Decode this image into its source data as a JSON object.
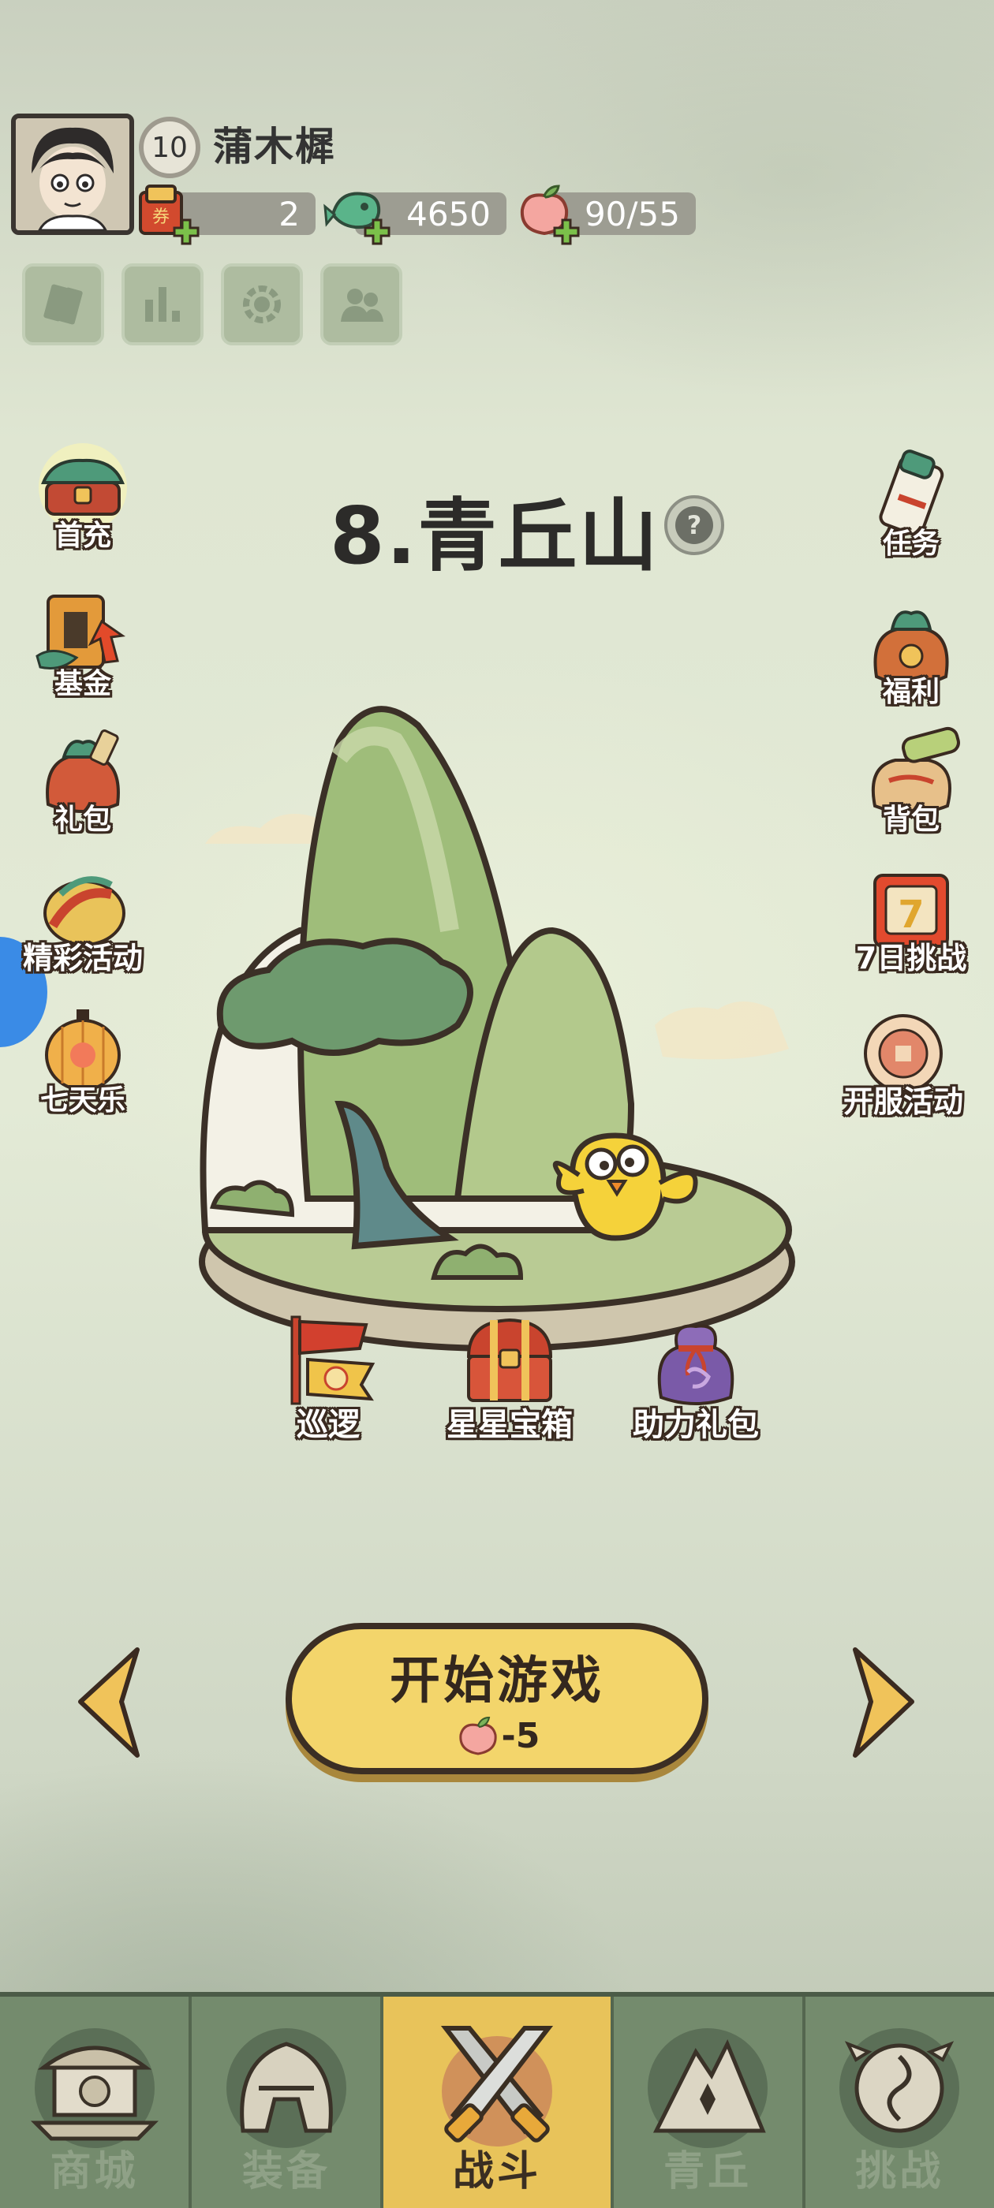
{
  "player": {
    "level": "10",
    "name": "蒲木樨"
  },
  "resources": [
    {
      "name": "coupon",
      "value": "2",
      "icon": "ticket-icon"
    },
    {
      "name": "jade",
      "value": "4650",
      "icon": "jade-fish-icon"
    },
    {
      "name": "peach_stamina",
      "value": "90/55",
      "icon": "peach-icon"
    }
  ],
  "toolbar": [
    {
      "icon": "cards-icon"
    },
    {
      "icon": "ranking-icon"
    },
    {
      "icon": "settings-icon"
    },
    {
      "icon": "friends-icon"
    }
  ],
  "left_menu": [
    {
      "label": "首充",
      "icon": "first-recharge-icon"
    },
    {
      "label": "基金",
      "icon": "fund-icon"
    },
    {
      "label": "礼包",
      "icon": "gift-bag-icon"
    },
    {
      "label": "精彩活动",
      "icon": "events-icon"
    },
    {
      "label": "七天乐",
      "icon": "lantern-icon"
    }
  ],
  "right_menu": [
    {
      "label": "任务",
      "icon": "scroll-icon"
    },
    {
      "label": "福利",
      "icon": "welfare-bag-icon"
    },
    {
      "label": "背包",
      "icon": "backpack-icon"
    },
    {
      "label": "7日挑战",
      "icon": "seven-day-icon"
    },
    {
      "label": "开服活动",
      "icon": "server-open-icon"
    }
  ],
  "stage": {
    "title": "8.青丘山"
  },
  "stage_actions": [
    {
      "label": "巡逻",
      "icon": "patrol-flag-icon"
    },
    {
      "label": "星星宝箱",
      "icon": "star-chest-icon"
    },
    {
      "label": "助力礼包",
      "icon": "assist-bag-icon"
    }
  ],
  "start_button": {
    "label": "开始游戏",
    "cost": "-5"
  },
  "nav": [
    {
      "label": "商城",
      "icon": "shop-icon",
      "active": false
    },
    {
      "label": "装备",
      "icon": "helmet-icon",
      "active": false
    },
    {
      "label": "战斗",
      "icon": "crossed-swords-icon",
      "active": true
    },
    {
      "label": "青丘",
      "icon": "mountain-icon",
      "active": false
    },
    {
      "label": "挑战",
      "icon": "challenge-icon",
      "active": false
    }
  ],
  "colors": {
    "accent": "#f3d56b",
    "nav_bg": "#748b6d",
    "nav_active": "#e8c35a"
  }
}
